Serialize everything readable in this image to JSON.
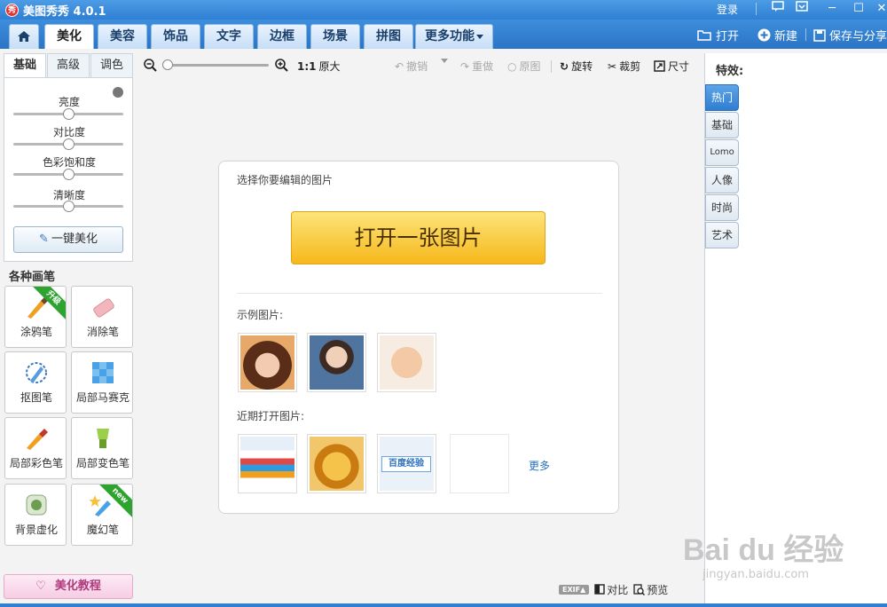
{
  "titlebar": {
    "logo_text": "秀",
    "title": "美图秀秀 4.0.1",
    "login": "登录",
    "minimize": "─",
    "maximize": "☐",
    "close": "✕"
  },
  "nav": {
    "tabs": [
      {
        "label": "美化",
        "active": true
      },
      {
        "label": "美容"
      },
      {
        "label": "饰品"
      },
      {
        "label": "文字"
      },
      {
        "label": "边框"
      },
      {
        "label": "场景"
      },
      {
        "label": "拼图"
      },
      {
        "label": "更多功能"
      }
    ],
    "open_label": "打开",
    "new_label": "新建",
    "save_label": "保存与分享"
  },
  "left_panel": {
    "subtabs": [
      "基础",
      "高级",
      "调色"
    ],
    "sliders": [
      {
        "label": "亮度",
        "value": 0.5
      },
      {
        "label": "对比度",
        "value": 0.5
      },
      {
        "label": "色彩饱和度",
        "value": 0.5
      },
      {
        "label": "清晰度",
        "value": 0.5
      }
    ],
    "one_key_button": "一键美化",
    "brush_section_title": "各种画笔",
    "brushes": [
      {
        "label": "涂鸦笔",
        "badge": "升级",
        "icon": "brush-icon"
      },
      {
        "label": "消除笔",
        "icon": "eraser-icon"
      },
      {
        "label": "抠图笔",
        "icon": "cutout-pen-icon"
      },
      {
        "label": "局部马赛克",
        "icon": "mosaic-icon"
      },
      {
        "label": "局部彩色笔",
        "icon": "color-brush-icon"
      },
      {
        "label": "局部变色笔",
        "icon": "color-change-icon"
      },
      {
        "label": "背景虚化",
        "icon": "blur-background-icon"
      },
      {
        "label": "魔幻笔",
        "badge": "new",
        "icon": "magic-pen-icon"
      }
    ],
    "tutorial_button": "美化教程"
  },
  "toolbar": {
    "zoom_level": 0.0,
    "actual_size_prefix": "1:1",
    "actual_size": "原大",
    "undo": "撤销",
    "redo": "重做",
    "original": "原图",
    "rotate": "旋转",
    "crop": "裁剪",
    "size": "尺寸"
  },
  "open_panel": {
    "title": "选择你要编辑的图片",
    "open_button": "打开一张图片",
    "sample_title": "示例图片:",
    "recent_title": "近期打开图片:",
    "recent_thumb_text": "百度经验",
    "more": "更多"
  },
  "bottom": {
    "exif": "EXIF▲",
    "compare": "对比",
    "preview": "预览"
  },
  "right_panel": {
    "title": "特效:",
    "tabs": [
      {
        "label": "热门",
        "active": true
      },
      {
        "label": "基础"
      },
      {
        "label": "Lomo"
      },
      {
        "label": "人像"
      },
      {
        "label": "时尚"
      },
      {
        "label": "艺术"
      }
    ]
  },
  "watermark": {
    "main": "Bai du 经验",
    "sub": "jingyan.baidu.com"
  },
  "colors": {
    "titlebar": "#2f7fd3",
    "open_button": "#f6b81c",
    "active_fx_tab": "#2f7ed1"
  }
}
